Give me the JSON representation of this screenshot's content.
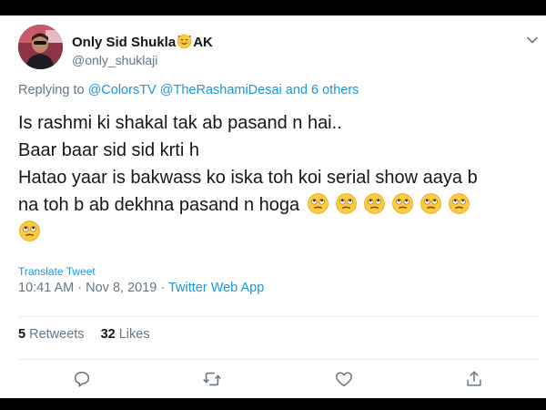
{
  "tweet": {
    "display_name": "Only Sid Shukla",
    "name_emoji_icon": "smiling-face-with-hearts-icon",
    "display_name_suffix": "AK",
    "handle": "@only_shuklaji",
    "reply_prefix": "Replying to",
    "reply_mention_1": "@ColorsTV",
    "reply_mention_2": "@TheRashamiDesai",
    "reply_others": "and 6 others",
    "text_lines": [
      "Is rashmi ki shakal tak ab pasand n hai..",
      "Baar baar sid sid krti h",
      "Hatao yaar is bakwass ko iska toh koi serial show aaya b",
      "na toh b ab dekhna pasand n hoga"
    ],
    "emoji_icon": "face-with-rolling-eyes-icon",
    "emoji_count": 7,
    "translate_label": "Translate Tweet",
    "timestamp": "10:41 AM · Nov 8, 2019",
    "separator": " · ",
    "source_app": "Twitter Web App",
    "retweets_count": "5",
    "retweets_label": "Retweets",
    "likes_count": "32",
    "likes_label": "Likes"
  },
  "actions": {
    "icons": [
      "reply-icon",
      "retweet-icon",
      "like-icon",
      "share-icon"
    ]
  },
  "colors": {
    "frame": "#000000",
    "card": "#ffffff",
    "text": "#14171a",
    "secondary": "#657786",
    "link": "#1b95e0",
    "divider": "#e6ecf0"
  }
}
